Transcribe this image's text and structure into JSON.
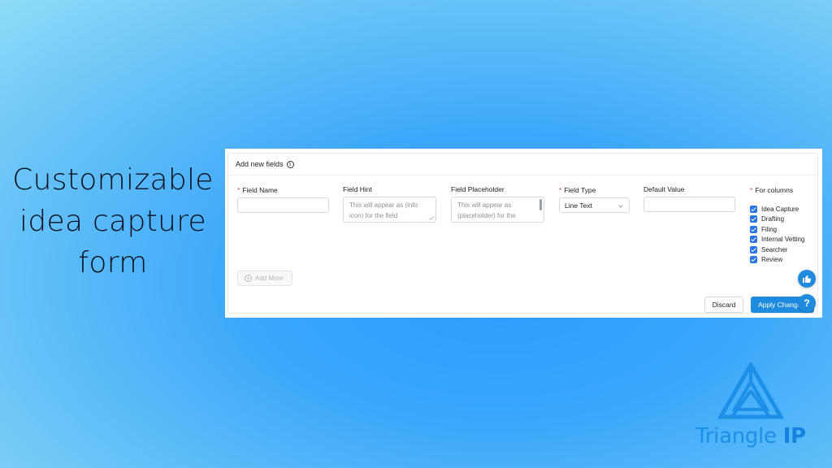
{
  "headline": [
    "Customizable",
    "idea capture",
    "form"
  ],
  "form": {
    "title": "Add new fields",
    "required_marker": "*",
    "field_name": {
      "label": "Field Name",
      "value": ""
    },
    "field_hint": {
      "label": "Field Hint",
      "placeholder_lines": [
        "This will appear as (info",
        "icon) for the field"
      ]
    },
    "field_placeholder": {
      "label": "Field Placeholder",
      "placeholder_lines": [
        "This will appear as",
        "(placeholder) for the"
      ]
    },
    "field_type": {
      "label": "Field Type",
      "selected": "Line Text"
    },
    "default_value": {
      "label": "Default Value",
      "value": ""
    },
    "for_columns": {
      "label": "For columns",
      "options": [
        {
          "label": "Idea Capture",
          "checked": true
        },
        {
          "label": "Drafting",
          "checked": true
        },
        {
          "label": "Filing",
          "checked": true
        },
        {
          "label": "Internal Vetting",
          "checked": true
        },
        {
          "label": "Searcher",
          "checked": true
        },
        {
          "label": "Review",
          "checked": true
        }
      ]
    },
    "add_more_label": "Add More",
    "discard_label": "Discard",
    "apply_label": "Apply Changes"
  },
  "help_glyph": "?",
  "brand": {
    "name_part1": "Triangle ",
    "name_part2": "IP"
  },
  "colors": {
    "accent": "#1f8bdf",
    "checkbox": "#2a74e6",
    "required": "#e0453a",
    "brand": "#1e8fe6"
  }
}
